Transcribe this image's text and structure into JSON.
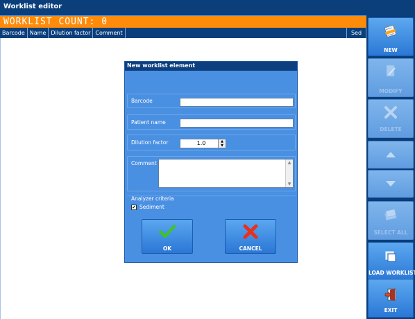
{
  "window": {
    "title": "Worklist editor"
  },
  "worklist": {
    "count_label": "WORKLIST COUNT: 0"
  },
  "table": {
    "columns": [
      "Barcode",
      "Name",
      "Dilution factor",
      "Comment",
      "Sed"
    ]
  },
  "sidebar": {
    "new_label": "NEW",
    "modify_label": "MODIFY",
    "delete_label": "DELETE",
    "select_all_label": "SELECT ALL",
    "load_worklist_label": "LOAD WORKLIST",
    "exit_label": "EXIT"
  },
  "dialog": {
    "title": "New worklist element",
    "barcode_label": "Barcode",
    "barcode_value": "",
    "patient_name_label": "Patient name",
    "patient_name_value": "",
    "dilution_label": "Dilution factor",
    "dilution_value": "1.0",
    "comment_label": "Comment",
    "comment_value": "",
    "criteria_title": "Analyzer criteria",
    "sediment_label": "Sediment",
    "sediment_checked": true,
    "ok_label": "OK",
    "cancel_label": "CANCEL"
  },
  "colors": {
    "accent_orange": "#ff8b0a",
    "titlebar_blue": "#0b3f7c",
    "dialog_blue": "#4a90e2",
    "ok_green": "#3ec61b",
    "cancel_red": "#e8301e"
  }
}
